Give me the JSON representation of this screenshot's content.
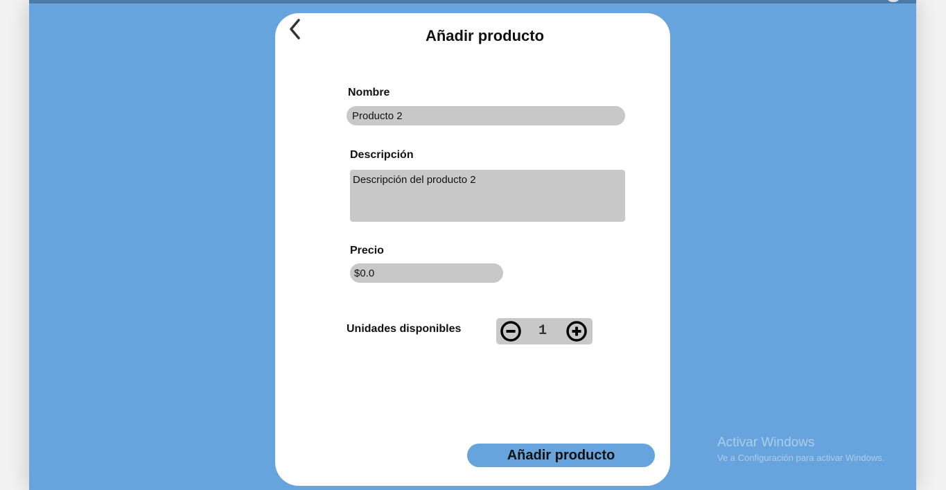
{
  "form": {
    "title": "Añadir producto",
    "back_icon": "chevron-left-icon",
    "name": {
      "label": "Nombre",
      "value": "Producto 2"
    },
    "description": {
      "label": "Descripción",
      "value": "Descripción del producto 2"
    },
    "price": {
      "label": "Precio",
      "value": "$0.0"
    },
    "units": {
      "label": "Unidades disponibles",
      "value": "1",
      "decrement_icon": "minus-circle-icon",
      "increment_icon": "plus-circle-icon"
    },
    "submit_label": "Añadir producto"
  },
  "watermark": {
    "title": "Activar Windows",
    "subtitle": "Ve a Configuración para activar Windows."
  },
  "colors": {
    "background": "#67a4dd",
    "topbar": "#4b79a8",
    "card": "#ffffff",
    "input": "#c8c8c8",
    "button": "#67a4dd"
  }
}
